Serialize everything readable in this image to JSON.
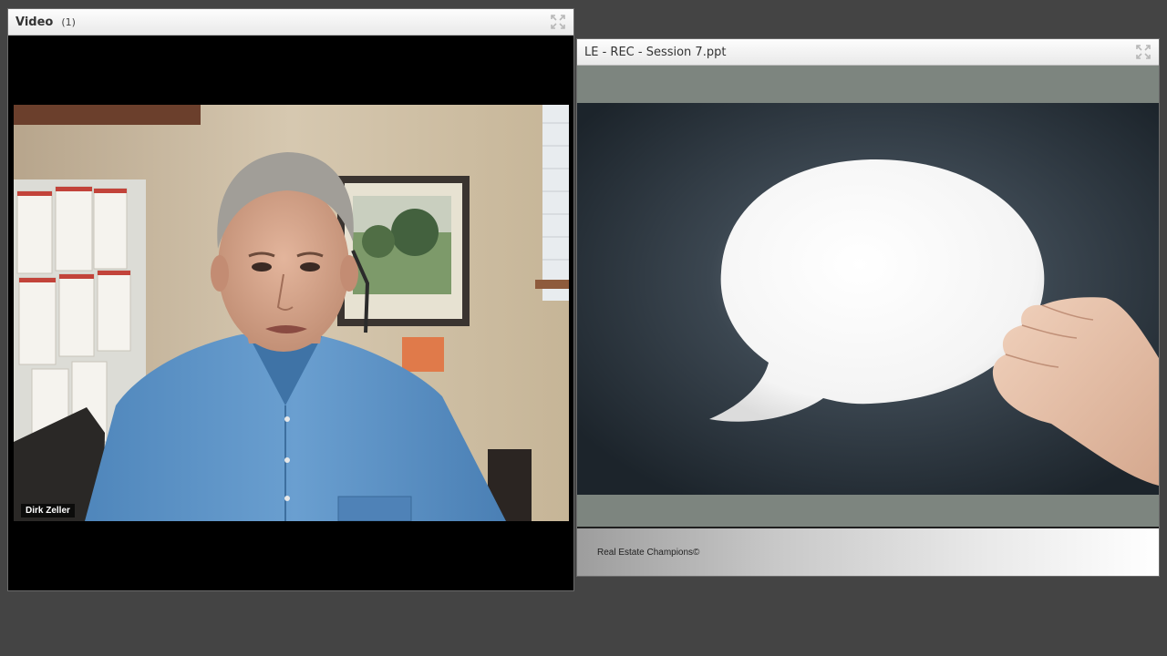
{
  "video_pod": {
    "title": "Video",
    "count": "(1)",
    "participant_name": "Dirk Zeller",
    "fullscreen_icon": "expand-icon"
  },
  "share_pod": {
    "title": "LE - REC - Session 7.ppt",
    "fullscreen_icon": "expand-icon",
    "slide_footer_text": "Real Estate Champions©",
    "slide_image": "speech-bubble-held-by-hand"
  },
  "colors": {
    "background": "#444444",
    "pod_header": "#f2f2f2",
    "shirt": "#5b91c4",
    "slide_bg": "#263038"
  }
}
